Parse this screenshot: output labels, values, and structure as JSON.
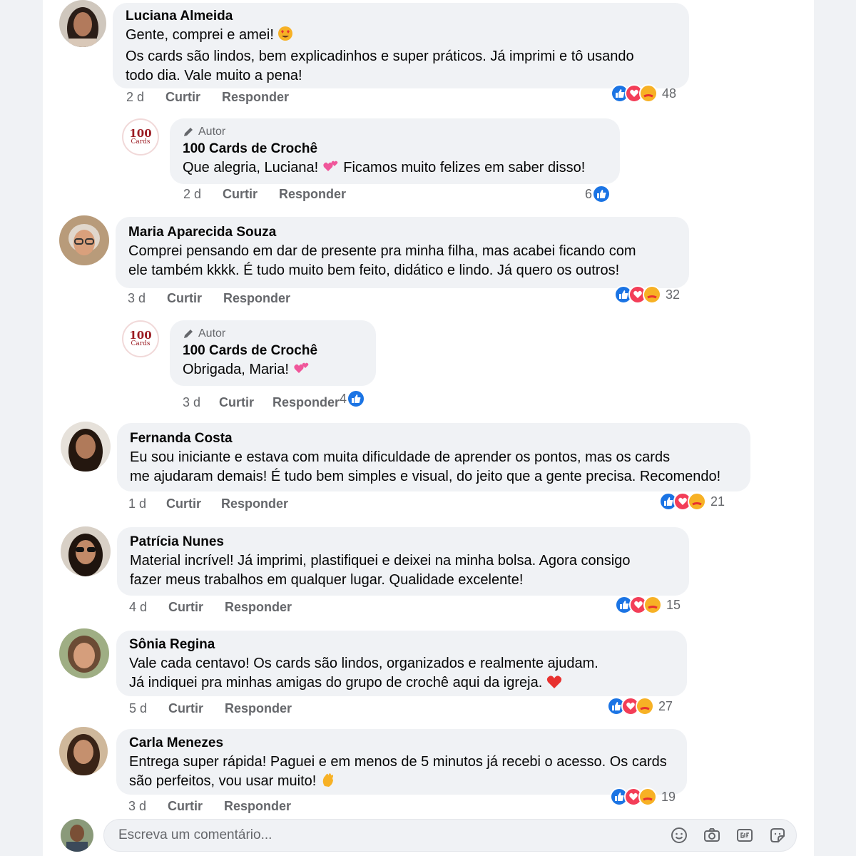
{
  "comments": [
    {
      "name": "Luciana Almeida",
      "lines": [
        "Gente, comprei e amei!",
        "Os cards são lindos, bem explicadinhos e super práticos. Já imprimi e tô usando",
        "todo dia. Vale muito a pena!"
      ],
      "time": "2 d",
      "like": "Curtir",
      "reply": "Responder",
      "reaction_count": "48",
      "reply_from_author": {
        "badge": "Autor",
        "name": "100 Cards de Crochê",
        "text": "Que alegria, Luciana!",
        "text2": "Ficamos muito felizes em saber disso!",
        "time": "2 d",
        "like": "Curtir",
        "reply": "Responder",
        "reaction_count": "6"
      }
    },
    {
      "name": "Maria Aparecida Souza",
      "lines": [
        "Comprei pensando em dar de presente pra minha filha, mas acabei ficando com",
        "ele também kkkk. É tudo muito bem feito, didático e lindo. Já quero os outros!"
      ],
      "time": "3 d",
      "like": "Curtir",
      "reply": "Responder",
      "reaction_count": "32",
      "reply_from_author": {
        "badge": "Autor",
        "name": "100 Cards de Crochê",
        "text": "Obrigada, Maria!",
        "time": "3 d",
        "like": "Curtir",
        "reply": "Responder",
        "reaction_count": "4"
      }
    },
    {
      "name": "Fernanda Costa",
      "lines": [
        "Eu sou iniciante e estava com muita dificuldade de aprender os pontos, mas os cards",
        "me ajudaram demais! É tudo bem simples e visual, do jeito que a gente precisa. Recomendo!"
      ],
      "time": "1 d",
      "like": "Curtir",
      "reply": "Responder",
      "reaction_count": "21"
    },
    {
      "name": "Patrícia Nunes",
      "lines": [
        "Material incrível! Já imprimi, plastifiquei e deixei na minha bolsa. Agora consigo",
        "fazer meus trabalhos em qualquer lugar. Qualidade excelente!"
      ],
      "time": "4 d",
      "like": "Curtir",
      "reply": "Responder",
      "reaction_count": "15"
    },
    {
      "name": "Sônia Regina",
      "lines": [
        "Vale cada centavo! Os cards são lindos, organizados e realmente ajudam.",
        "Já indiquei pra minhas amigas do grupo de crochê aqui da igreja."
      ],
      "time": "5 d",
      "like": "Curtir",
      "reply": "Responder",
      "reaction_count": "27"
    },
    {
      "name": "Carla Menezes",
      "lines": [
        "Entrega super rápida! Paguei e em menos de 5 minutos já recebi o acesso. Os cards",
        "são perfeitos, vou usar muito!"
      ],
      "time": "3 d",
      "like": "Curtir",
      "reply": "Responder",
      "reaction_count": "19"
    }
  ],
  "page_avatar": {
    "number": "100",
    "word": "Cards"
  },
  "composer": {
    "placeholder": "Escreva um comentário..."
  },
  "icons": {
    "reactions": [
      "like-icon",
      "love-icon",
      "care-icon"
    ],
    "composer": [
      "emoji-icon",
      "camera-icon",
      "gif-icon",
      "sticker-icon"
    ],
    "author_badge": "pencil-icon"
  },
  "colors": {
    "like": "#1b74e4",
    "love": "#f33e58",
    "care": "#f7b125",
    "bubble": "#f0f2f5",
    "muted": "#65676b"
  }
}
